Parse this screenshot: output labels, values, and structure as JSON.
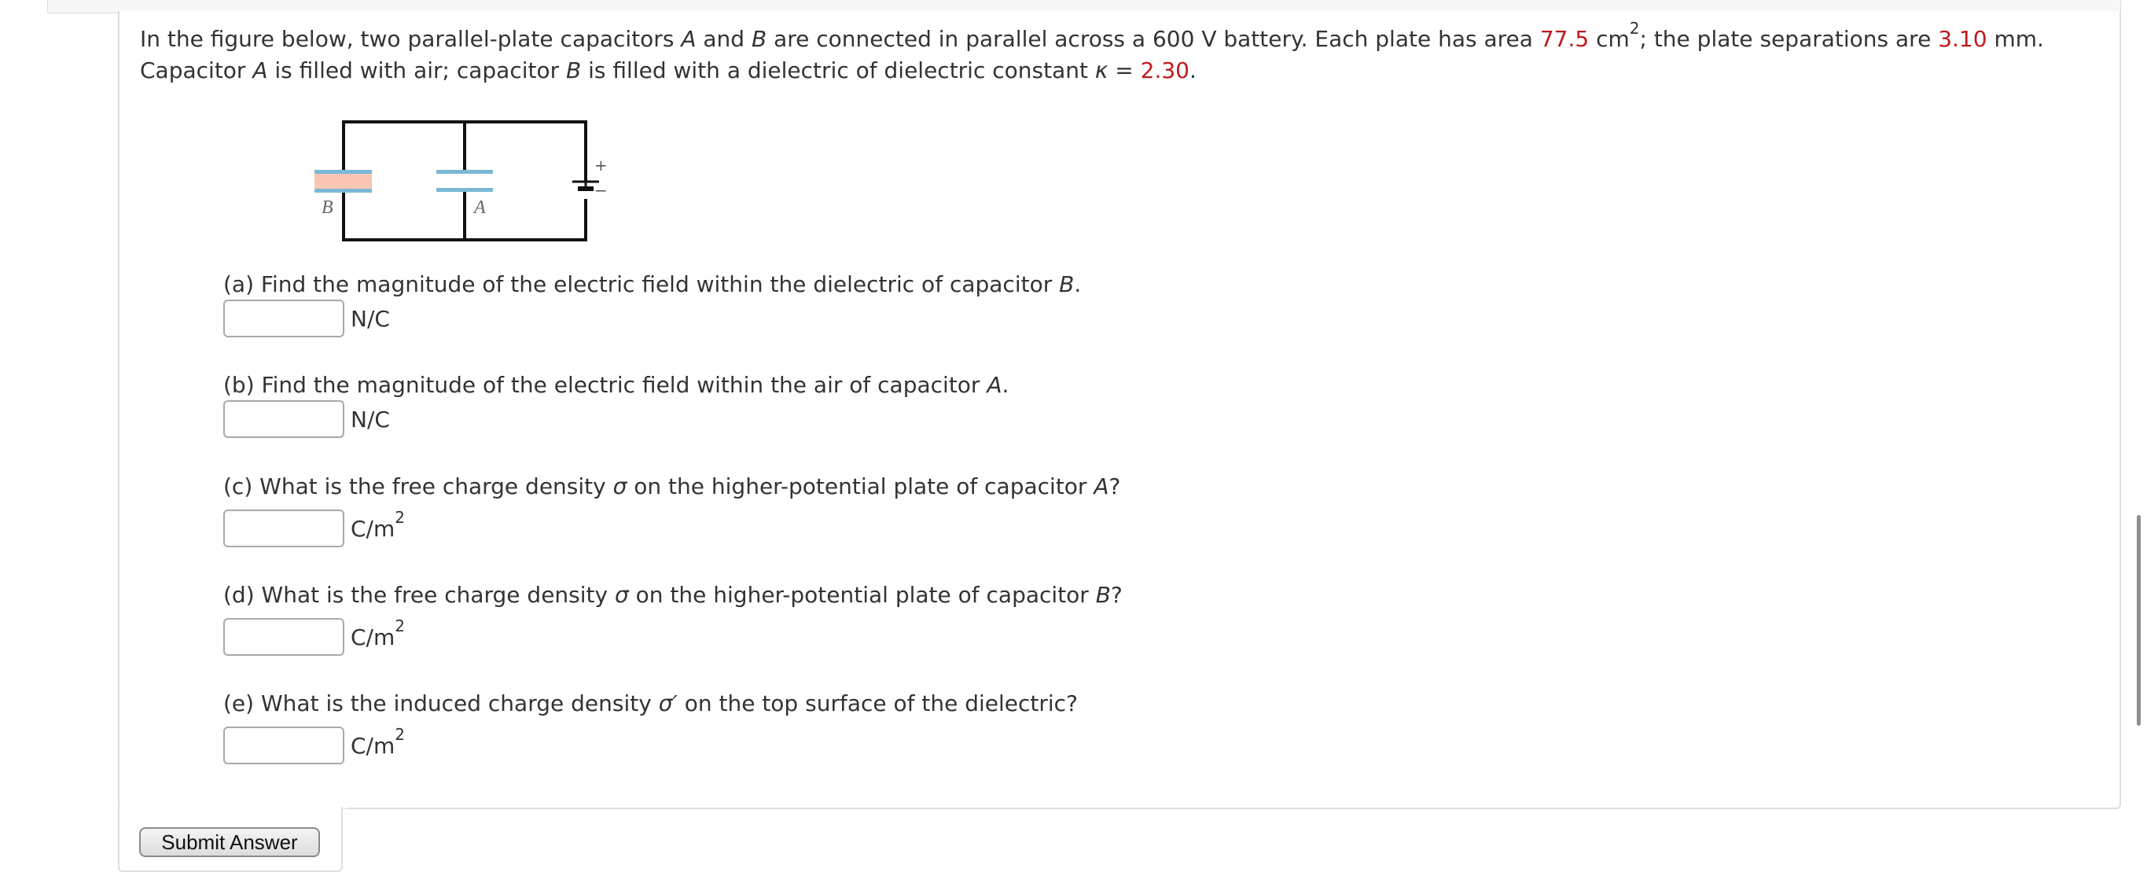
{
  "intro": {
    "p1": "In the figure below, two parallel-plate capacitors ",
    "capA1": "A",
    "p2": " and ",
    "capB1": "B",
    "p3": " are connected in parallel across a 600 V battery. Each plate has area ",
    "area": "77.5",
    "p4": " cm",
    "sup1": "2",
    "p5": "; the plate separations are ",
    "sep": "3.10",
    "p6": " mm. Capacitor ",
    "capA2": "A",
    "p7": " is filled with air; capacitor ",
    "capB2": "B",
    "p8": " is filled with a dielectric of dielectric constant ",
    "kappa": "κ",
    "p9": " = ",
    "kval": "2.30",
    "p10": "."
  },
  "figure": {
    "label_b": "B",
    "label_a": "A",
    "plus": "+",
    "minus": "−",
    "colors": {
      "plate": "#7ab8d6",
      "dielectric": "#f9c5b5",
      "wire": "#111111"
    }
  },
  "questions": [
    {
      "pre": "(a) Find the magnitude of the electric field within the dielectric of capacitor ",
      "var": "B",
      "post": ".",
      "unit": "N/C",
      "unit_sup": ""
    },
    {
      "pre": "(b) Find the magnitude of the electric field within the air of capacitor ",
      "var": "A",
      "post": ".",
      "unit": "N/C",
      "unit_sup": ""
    },
    {
      "pre": "(c) What is the free charge density ",
      "sym": "σ",
      "mid": " on the higher-potential plate of capacitor ",
      "var": "A",
      "post": "?",
      "unit": "C/m",
      "unit_sup": "2"
    },
    {
      "pre": "(d) What is the free charge density ",
      "sym": "σ",
      "mid": " on the higher-potential plate of capacitor ",
      "var": "B",
      "post": "?",
      "unit": "C/m",
      "unit_sup": "2"
    },
    {
      "pre": "(e) What is the induced charge density ",
      "sym": "σ′",
      "mid": " on the top surface of the dielectric?",
      "unit": "C/m",
      "unit_sup": "2"
    }
  ],
  "submit_label": "Submit Answer"
}
